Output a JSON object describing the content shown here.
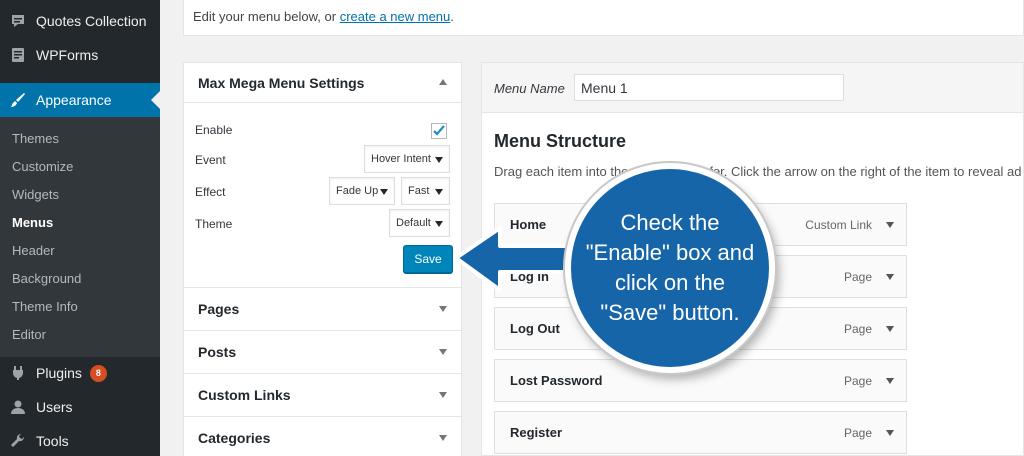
{
  "sidebar": {
    "items": [
      {
        "label": "Quotes Collection",
        "icon": "quote-icon"
      },
      {
        "label": "WPForms",
        "icon": "forms-icon"
      },
      {
        "label": "Appearance",
        "icon": "paintbrush-icon"
      },
      {
        "label": "Plugins",
        "icon": "plugin-icon",
        "badge": "8"
      },
      {
        "label": "Users",
        "icon": "user-icon"
      },
      {
        "label": "Tools",
        "icon": "wrench-icon"
      }
    ],
    "submenu": [
      "Themes",
      "Customize",
      "Widgets",
      "Menus",
      "Header",
      "Background",
      "Theme Info",
      "Editor"
    ]
  },
  "notice": {
    "text": "Edit your menu below, or ",
    "link": "create a new menu",
    "suffix": "."
  },
  "settings": {
    "title": "Max Mega Menu Settings",
    "enable_label": "Enable",
    "enable_checked": true,
    "event_label": "Event",
    "event_value": "Hover Intent",
    "effect_label": "Effect",
    "effect_value": "Fade Up",
    "effect_speed": "Fast",
    "theme_label": "Theme",
    "theme_value": "Default",
    "save_label": "Save"
  },
  "accordion": [
    "Pages",
    "Posts",
    "Custom Links",
    "Categories"
  ],
  "menu": {
    "name_label": "Menu Name",
    "name_value": "Menu 1",
    "structure_title": "Menu Structure",
    "structure_desc": "Drag each item into the order you prefer. Click the arrow on the right of the item to reveal ad",
    "items": [
      {
        "title": "Home",
        "type": "Custom Link"
      },
      {
        "title": "Log In",
        "type": "Page"
      },
      {
        "title": "Log Out",
        "type": "Page"
      },
      {
        "title": "Lost Password",
        "type": "Page"
      },
      {
        "title": "Register",
        "type": "Page"
      }
    ]
  },
  "callout": {
    "text": "Check the \"Enable\" box and click on the \"Save\" button."
  },
  "colors": {
    "accent": "#0073aa",
    "sidebar": "#23282d",
    "callout": "#1565a8"
  }
}
